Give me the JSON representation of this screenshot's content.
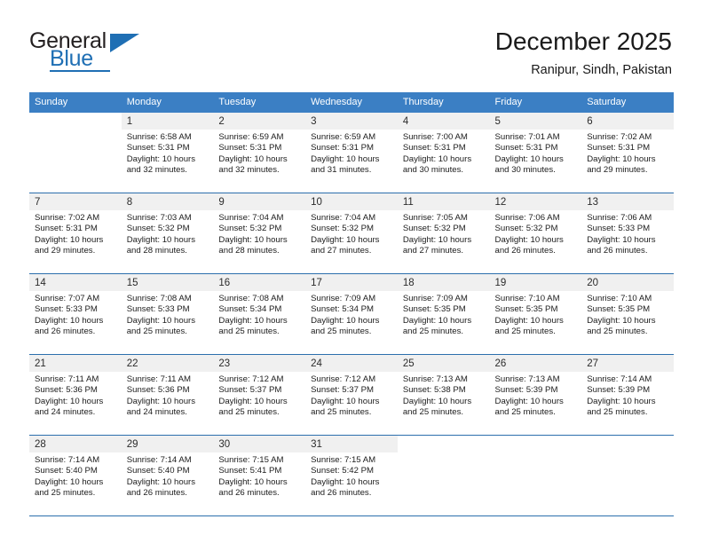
{
  "brand": {
    "word_one": "General",
    "word_two": "Blue",
    "triangle_icon": "triangle-icon"
  },
  "header": {
    "title": "December 2025",
    "subtitle": "Ranipur, Sindh, Pakistan"
  },
  "colors": {
    "header_blue": "#3b7fc4",
    "row_rule_blue": "#2c6fad",
    "daynum_bg": "#f0f0f0",
    "brand_blue": "#1f6fb4",
    "text": "#1c1c1c"
  },
  "calendar": {
    "weekday_headers": [
      "Sunday",
      "Monday",
      "Tuesday",
      "Wednesday",
      "Thursday",
      "Friday",
      "Saturday"
    ],
    "labels": {
      "sunrise": "Sunrise:",
      "sunset": "Sunset:",
      "daylight": "Daylight:"
    },
    "weeks": [
      [
        {
          "day": "",
          "empty": true
        },
        {
          "day": "1",
          "sunrise": "Sunrise: 6:58 AM",
          "sunset": "Sunset: 5:31 PM",
          "daylight_1": "Daylight: 10 hours",
          "daylight_2": "and 32 minutes."
        },
        {
          "day": "2",
          "sunrise": "Sunrise: 6:59 AM",
          "sunset": "Sunset: 5:31 PM",
          "daylight_1": "Daylight: 10 hours",
          "daylight_2": "and 32 minutes."
        },
        {
          "day": "3",
          "sunrise": "Sunrise: 6:59 AM",
          "sunset": "Sunset: 5:31 PM",
          "daylight_1": "Daylight: 10 hours",
          "daylight_2": "and 31 minutes."
        },
        {
          "day": "4",
          "sunrise": "Sunrise: 7:00 AM",
          "sunset": "Sunset: 5:31 PM",
          "daylight_1": "Daylight: 10 hours",
          "daylight_2": "and 30 minutes."
        },
        {
          "day": "5",
          "sunrise": "Sunrise: 7:01 AM",
          "sunset": "Sunset: 5:31 PM",
          "daylight_1": "Daylight: 10 hours",
          "daylight_2": "and 30 minutes."
        },
        {
          "day": "6",
          "sunrise": "Sunrise: 7:02 AM",
          "sunset": "Sunset: 5:31 PM",
          "daylight_1": "Daylight: 10 hours",
          "daylight_2": "and 29 minutes."
        }
      ],
      [
        {
          "day": "7",
          "sunrise": "Sunrise: 7:02 AM",
          "sunset": "Sunset: 5:31 PM",
          "daylight_1": "Daylight: 10 hours",
          "daylight_2": "and 29 minutes."
        },
        {
          "day": "8",
          "sunrise": "Sunrise: 7:03 AM",
          "sunset": "Sunset: 5:32 PM",
          "daylight_1": "Daylight: 10 hours",
          "daylight_2": "and 28 minutes."
        },
        {
          "day": "9",
          "sunrise": "Sunrise: 7:04 AM",
          "sunset": "Sunset: 5:32 PM",
          "daylight_1": "Daylight: 10 hours",
          "daylight_2": "and 28 minutes."
        },
        {
          "day": "10",
          "sunrise": "Sunrise: 7:04 AM",
          "sunset": "Sunset: 5:32 PM",
          "daylight_1": "Daylight: 10 hours",
          "daylight_2": "and 27 minutes."
        },
        {
          "day": "11",
          "sunrise": "Sunrise: 7:05 AM",
          "sunset": "Sunset: 5:32 PM",
          "daylight_1": "Daylight: 10 hours",
          "daylight_2": "and 27 minutes."
        },
        {
          "day": "12",
          "sunrise": "Sunrise: 7:06 AM",
          "sunset": "Sunset: 5:32 PM",
          "daylight_1": "Daylight: 10 hours",
          "daylight_2": "and 26 minutes."
        },
        {
          "day": "13",
          "sunrise": "Sunrise: 7:06 AM",
          "sunset": "Sunset: 5:33 PM",
          "daylight_1": "Daylight: 10 hours",
          "daylight_2": "and 26 minutes."
        }
      ],
      [
        {
          "day": "14",
          "sunrise": "Sunrise: 7:07 AM",
          "sunset": "Sunset: 5:33 PM",
          "daylight_1": "Daylight: 10 hours",
          "daylight_2": "and 26 minutes."
        },
        {
          "day": "15",
          "sunrise": "Sunrise: 7:08 AM",
          "sunset": "Sunset: 5:33 PM",
          "daylight_1": "Daylight: 10 hours",
          "daylight_2": "and 25 minutes."
        },
        {
          "day": "16",
          "sunrise": "Sunrise: 7:08 AM",
          "sunset": "Sunset: 5:34 PM",
          "daylight_1": "Daylight: 10 hours",
          "daylight_2": "and 25 minutes."
        },
        {
          "day": "17",
          "sunrise": "Sunrise: 7:09 AM",
          "sunset": "Sunset: 5:34 PM",
          "daylight_1": "Daylight: 10 hours",
          "daylight_2": "and 25 minutes."
        },
        {
          "day": "18",
          "sunrise": "Sunrise: 7:09 AM",
          "sunset": "Sunset: 5:35 PM",
          "daylight_1": "Daylight: 10 hours",
          "daylight_2": "and 25 minutes."
        },
        {
          "day": "19",
          "sunrise": "Sunrise: 7:10 AM",
          "sunset": "Sunset: 5:35 PM",
          "daylight_1": "Daylight: 10 hours",
          "daylight_2": "and 25 minutes."
        },
        {
          "day": "20",
          "sunrise": "Sunrise: 7:10 AM",
          "sunset": "Sunset: 5:35 PM",
          "daylight_1": "Daylight: 10 hours",
          "daylight_2": "and 25 minutes."
        }
      ],
      [
        {
          "day": "21",
          "sunrise": "Sunrise: 7:11 AM",
          "sunset": "Sunset: 5:36 PM",
          "daylight_1": "Daylight: 10 hours",
          "daylight_2": "and 24 minutes."
        },
        {
          "day": "22",
          "sunrise": "Sunrise: 7:11 AM",
          "sunset": "Sunset: 5:36 PM",
          "daylight_1": "Daylight: 10 hours",
          "daylight_2": "and 24 minutes."
        },
        {
          "day": "23",
          "sunrise": "Sunrise: 7:12 AM",
          "sunset": "Sunset: 5:37 PM",
          "daylight_1": "Daylight: 10 hours",
          "daylight_2": "and 25 minutes."
        },
        {
          "day": "24",
          "sunrise": "Sunrise: 7:12 AM",
          "sunset": "Sunset: 5:37 PM",
          "daylight_1": "Daylight: 10 hours",
          "daylight_2": "and 25 minutes."
        },
        {
          "day": "25",
          "sunrise": "Sunrise: 7:13 AM",
          "sunset": "Sunset: 5:38 PM",
          "daylight_1": "Daylight: 10 hours",
          "daylight_2": "and 25 minutes."
        },
        {
          "day": "26",
          "sunrise": "Sunrise: 7:13 AM",
          "sunset": "Sunset: 5:39 PM",
          "daylight_1": "Daylight: 10 hours",
          "daylight_2": "and 25 minutes."
        },
        {
          "day": "27",
          "sunrise": "Sunrise: 7:14 AM",
          "sunset": "Sunset: 5:39 PM",
          "daylight_1": "Daylight: 10 hours",
          "daylight_2": "and 25 minutes."
        }
      ],
      [
        {
          "day": "28",
          "sunrise": "Sunrise: 7:14 AM",
          "sunset": "Sunset: 5:40 PM",
          "daylight_1": "Daylight: 10 hours",
          "daylight_2": "and 25 minutes."
        },
        {
          "day": "29",
          "sunrise": "Sunrise: 7:14 AM",
          "sunset": "Sunset: 5:40 PM",
          "daylight_1": "Daylight: 10 hours",
          "daylight_2": "and 26 minutes."
        },
        {
          "day": "30",
          "sunrise": "Sunrise: 7:15 AM",
          "sunset": "Sunset: 5:41 PM",
          "daylight_1": "Daylight: 10 hours",
          "daylight_2": "and 26 minutes."
        },
        {
          "day": "31",
          "sunrise": "Sunrise: 7:15 AM",
          "sunset": "Sunset: 5:42 PM",
          "daylight_1": "Daylight: 10 hours",
          "daylight_2": "and 26 minutes."
        },
        {
          "day": "",
          "empty": true
        },
        {
          "day": "",
          "empty": true
        },
        {
          "day": "",
          "empty": true
        }
      ]
    ]
  }
}
